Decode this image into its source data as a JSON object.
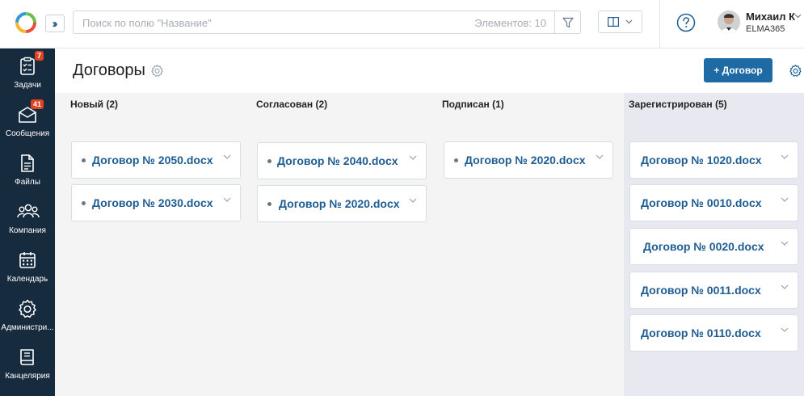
{
  "topbar": {
    "search_placeholder": "Поиск по полю \"Название\"",
    "elements_count": "Элементов: 10",
    "user_name": "Михаил К",
    "user_org": "ELMA365"
  },
  "sidebar": {
    "items": [
      {
        "label": "Задачи",
        "icon": "tasks-icon",
        "badge": "7"
      },
      {
        "label": "Сообщения",
        "icon": "messages-icon",
        "badge": "41"
      },
      {
        "label": "Файлы",
        "icon": "files-icon"
      },
      {
        "label": "Компания",
        "icon": "company-icon"
      },
      {
        "label": "Календарь",
        "icon": "calendar-icon"
      },
      {
        "label": "Администри...",
        "icon": "admin-gear-icon"
      },
      {
        "label": "Канцелярия",
        "icon": "office-book-icon"
      }
    ]
  },
  "page": {
    "title": "Договоры",
    "add_button": "+ Договор"
  },
  "board": {
    "columns": [
      {
        "title": "Новый (2)",
        "cards": [
          "Договор № 2050.docx",
          "Договор № 2030.docx"
        ]
      },
      {
        "title": "Согласован (2)",
        "cards": [
          "Договор № 2040.docx",
          "Договор № 2020.docx"
        ]
      },
      {
        "title": "Подписан (1)",
        "cards": [
          "Договор № 2020.docx"
        ]
      },
      {
        "title": "Зарегистрирован (5)",
        "cards": [
          "Договор № 1020.docx",
          "Договор № 0010.docx",
          "Договор № 0020.docx",
          "Договор № 0011.docx",
          "Договор № 0110.docx"
        ]
      }
    ]
  },
  "colors": {
    "sidebar_bg": "#172b3f",
    "accent": "#1e6aa5",
    "link": "#1e5c91",
    "badge": "#e04324",
    "registered_column_bg": "#e8e8f1"
  }
}
